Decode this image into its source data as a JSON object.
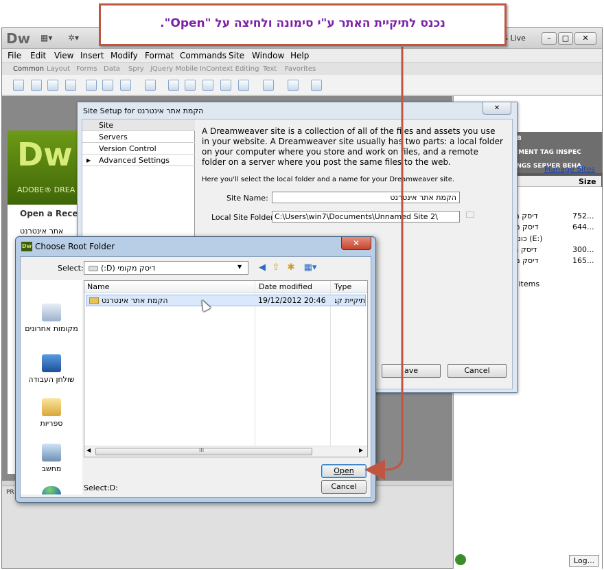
{
  "annotation": {
    "text": "נכנס לתיקיית האתר ע\"י סימונה ולחיצה על \"Open\".",
    "accent_color": "#c05541",
    "text_color": "#7c22a8"
  },
  "dw": {
    "logo": "Dw",
    "cs_live": "S Live",
    "menu": [
      "File",
      "Edit",
      "View",
      "Insert",
      "Modify",
      "Format",
      "Commands",
      "Site",
      "Window",
      "Help"
    ],
    "insert_tabs": [
      "Common",
      "Layout",
      "Forms",
      "Data",
      "Spry",
      "jQuery Mobile",
      "InContext Editing",
      "Text",
      "Favorites"
    ],
    "welcome": {
      "logo": "Dw",
      "brand": "ADOBE® DREA",
      "open_recent": "Open a Recent",
      "recent_file": "אתר אינטרנט"
    },
    "properties_label": "PR",
    "panels": {
      "tabs": [
        "B",
        "EMENT TAG INSPEC",
        "INGS SERVER BEHA",
        "NIPPETS"
      ],
      "manage_sites": "Manage Sites",
      "size_header": "Size",
      "drives": [
        {
          "name": "דיסק מק (C:)",
          "size": "752..."
        },
        {
          "name": "דיסק מק (D:)",
          "size": "644..."
        },
        {
          "name": "D RW כונן (E:)",
          "size": ""
        },
        {
          "name": "דיסק מק (F:)",
          "size": "300..."
        },
        {
          "name": "דיסק מק (G:)",
          "size": "165..."
        }
      ],
      "items_text": "p items",
      "log_button": "Log..."
    }
  },
  "site_setup": {
    "title": "Site Setup for הקמת אתר אינטרנט",
    "close": "✕",
    "nav": [
      "Site",
      "Servers",
      "Version Control",
      "Advanced Settings"
    ],
    "description": "A Dreamweaver site is a collection of all of the files and assets you use in your website. A Dreamweaver site usually has two parts: a local folder on your computer where you store and work on files, and a remote folder on a server where you post the same files to the web.",
    "hint": "Here you'll select the local folder and a name for your Dreamweaver site.",
    "site_name_label": "Site Name:",
    "site_name_value": "הקמת אתר אינטרנט",
    "local_folder_label": "Local Site Folder:",
    "local_folder_value": "C:\\Users\\win7\\Documents\\Unnamed Site 2\\",
    "save_button": "ave",
    "cancel_button": "Cancel"
  },
  "choose_root": {
    "title": "Choose Root Folder",
    "close": "✕",
    "select_label": "Select:",
    "select_value": "דיסק מקומי (D:)",
    "places": [
      "מקומות אחרונים",
      "שולחן העבודה",
      "ספריות",
      "מחשב",
      "Network"
    ],
    "columns": {
      "name": "Name",
      "date": "Date modified",
      "type": "Type"
    },
    "row": {
      "name": "הקמת אתר אינטרנט",
      "date": "19/12/2012 20:46",
      "type": "תיקיית קבצים"
    },
    "scroll_grip": "III",
    "path": "Select:D:",
    "open_button": "Open",
    "cancel_button": "Cancel"
  }
}
